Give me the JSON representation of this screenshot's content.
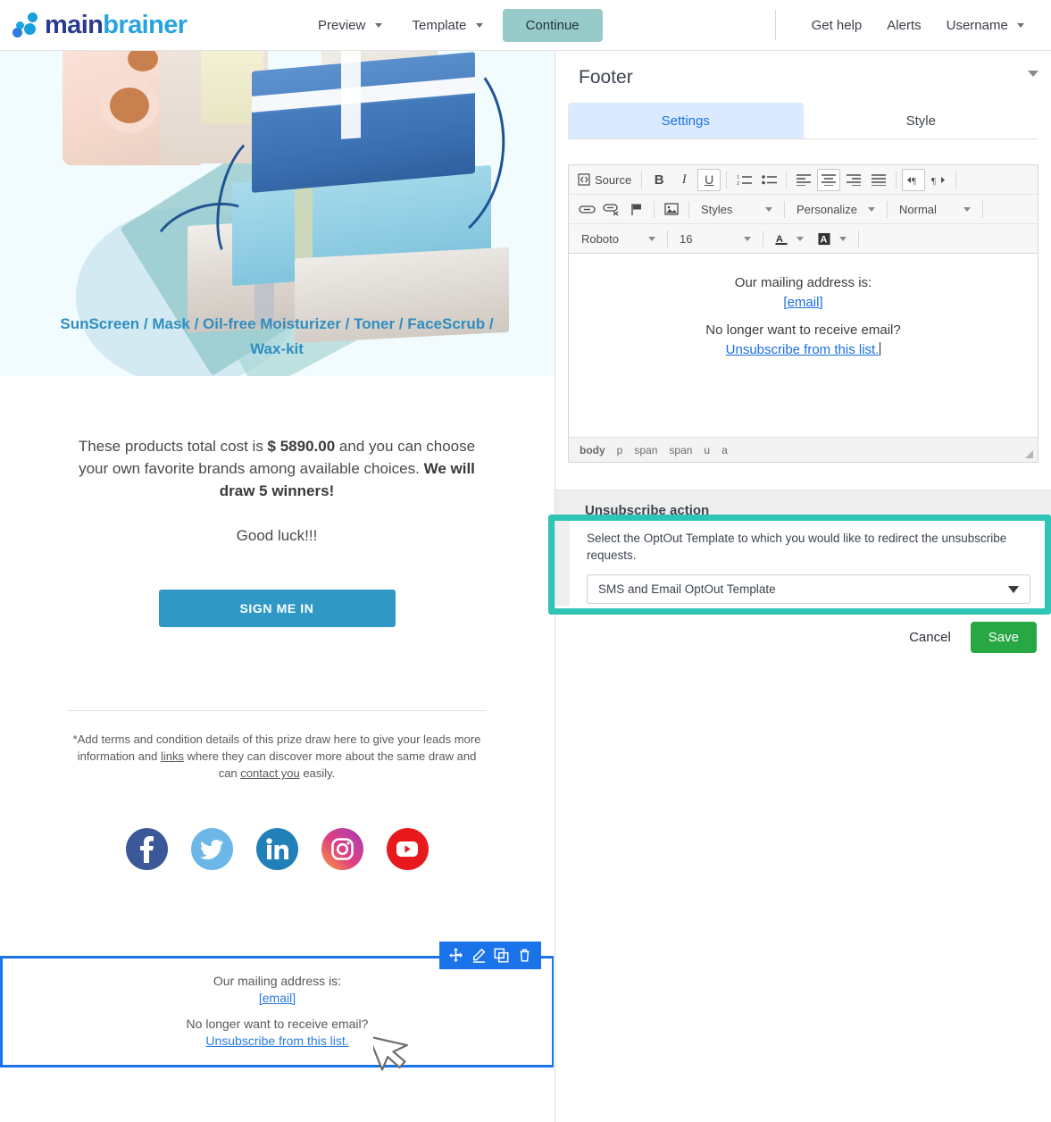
{
  "header": {
    "brand_main": "main",
    "brand_sub": "brainer",
    "nav": [
      {
        "label": "Preview",
        "caret": true
      },
      {
        "label": "Template",
        "caret": true
      }
    ],
    "continue_label": "Continue",
    "right_links": [
      {
        "label": "Get help",
        "caret": false
      },
      {
        "label": "Alerts",
        "caret": false
      },
      {
        "label": "Username",
        "caret": true
      }
    ]
  },
  "email": {
    "product_line": "SunScreen / Mask / Oil-free Moisturizer / Toner / FaceScrub / Wax-kit",
    "body_pre": "These products total cost is ",
    "body_price": "$ 5890.00",
    "body_mid": " and you can choose your own favorite brands among available choices. ",
    "body_bold": "We will draw 5 winners!",
    "good_luck": "Good luck!!!",
    "signin_label": "SIGN ME IN",
    "terms_pre": "*Add terms and condition details of this prize draw here to give your leads more information and ",
    "terms_link1": "links",
    "terms_mid": " where they can discover more about the same draw and can ",
    "terms_link2": "contact you",
    "terms_post": " easily.",
    "social": [
      {
        "name": "facebook",
        "label": "Facebook"
      },
      {
        "name": "twitter",
        "label": "Twitter"
      },
      {
        "name": "linkedin",
        "label": "LinkedIn"
      },
      {
        "name": "instagram",
        "label": "Instagram"
      },
      {
        "name": "youtube",
        "label": "YouTube"
      }
    ],
    "footer_block": {
      "line1": "Our mailing address is:",
      "email_link": "[email]",
      "line2": "No longer want to receive email?",
      "unsub_link": "Unsubscribe from this list.",
      "toolbar": [
        {
          "name": "move-icon",
          "label": "Move"
        },
        {
          "name": "edit-icon",
          "label": "Edit"
        },
        {
          "name": "duplicate-icon",
          "label": "Duplicate"
        },
        {
          "name": "delete-icon",
          "label": "Delete"
        }
      ]
    }
  },
  "panel": {
    "title": "Footer",
    "tabs": [
      {
        "label": "Settings",
        "active": true
      },
      {
        "label": "Style",
        "active": false
      }
    ],
    "toolbar": {
      "source_label": "Source",
      "row1": [
        {
          "name": "bold-icon",
          "label": "B"
        },
        {
          "name": "italic-icon",
          "label": "I"
        },
        {
          "name": "underline-icon",
          "label": "U"
        }
      ],
      "styles_label": "Styles",
      "personalize_label": "Personalize",
      "format_label": "Normal",
      "font_label": "Roboto",
      "size_label": "16"
    },
    "editor": {
      "line1": "Our mailing address is:",
      "email_link": "[email]",
      "line2": "No longer want to receive email?",
      "unsub_link": "Unsubscribe from this list.",
      "element_path": [
        "body",
        "p",
        "span",
        "span",
        "u",
        "a"
      ]
    },
    "unsubscribe": {
      "section_title": "Unsubscribe action",
      "description": "Select the OptOut Template to which you would like to redirect the unsubscribe requests.",
      "selected_template": "SMS and Email OptOut Template"
    },
    "actions": {
      "cancel_label": "Cancel",
      "save_label": "Save"
    }
  },
  "colors": {
    "brand_dark_blue": "#2b3a8f",
    "brand_light_blue": "#27a3e0",
    "continue_btn": "#96cbc9",
    "tab_active_bg": "#dbeafe",
    "tab_active_text": "#1a73e8",
    "save_green": "#28a745",
    "highlight_teal": "#2ec4b6",
    "selection_blue": "#1a73e8",
    "signin_blue": "#2f98c4",
    "product_link_blue": "#2e8fc0"
  }
}
